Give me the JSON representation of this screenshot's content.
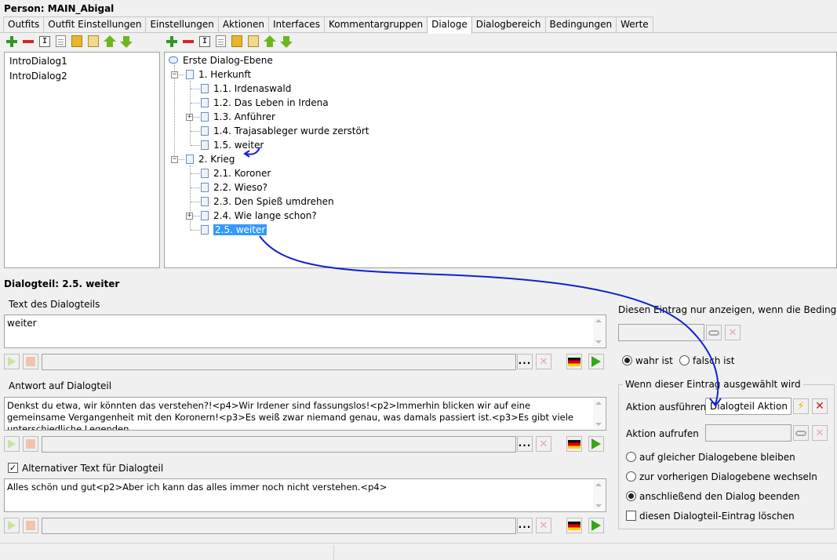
{
  "window": {
    "title": "Person: MAIN_Abigal"
  },
  "tabs": [
    {
      "label": "Outfits"
    },
    {
      "label": "Outfit Einstellungen"
    },
    {
      "label": "Einstellungen"
    },
    {
      "label": "Aktionen"
    },
    {
      "label": "Interfaces"
    },
    {
      "label": "Kommentargruppen"
    },
    {
      "label": "Dialoge",
      "active": true
    },
    {
      "label": "Dialogbereich"
    },
    {
      "label": "Bedingungen"
    },
    {
      "label": "Werte"
    }
  ],
  "toolbar_icons": [
    "add-icon",
    "remove-icon",
    "rename-icon",
    "new-document-icon",
    "copy-icon",
    "paste-icon",
    "move-up-icon",
    "move-down-icon"
  ],
  "dialog_list": {
    "items": [
      "IntroDialog1",
      "IntroDialog2"
    ],
    "selected": "IntroDialog1"
  },
  "tree": {
    "root": "Erste Dialog-Ebene",
    "nodes": [
      {
        "label": "1. Herkunft",
        "children": [
          {
            "label": "1.1. Irdenaswald"
          },
          {
            "label": "1.2. Das Leben in Irdena"
          },
          {
            "label": "1.3. Anführer",
            "expandable": true
          },
          {
            "label": "1.4. Trajasableger wurde zerstört"
          },
          {
            "label": "1.5. weiter"
          }
        ]
      },
      {
        "label": "2. Krieg",
        "children": [
          {
            "label": "2.1. Koroner"
          },
          {
            "label": "2.2. Wieso?"
          },
          {
            "label": "2.3. Den Spieß umdrehen"
          },
          {
            "label": "2.4. Wie lange schon?",
            "expandable": true
          },
          {
            "label": "2.5. weiter",
            "selected": true
          }
        ]
      }
    ]
  },
  "detail": {
    "heading": "Dialogteil: 2.5. weiter",
    "text_label": "Text des Dialogteils",
    "text_value": "weiter",
    "answer_label": "Antwort auf Dialogteil",
    "answer_value": "Denkst du etwa, wir könnten das verstehen?!<p4>Wir Irdener sind fassungslos!<p2>Immerhin blicken wir auf eine gemeinsame Vergangenheit mit den Koronern!<p3>Es weiß zwar niemand  genau, was damals passiert ist.<p3>Es gibt viele unterschiedliche Legenden",
    "alt_checkbox_label": "Alternativer Text für Dialogteil",
    "alt_checked": true,
    "alt_value": "Alles schön und gut<p2>Aber ich kann das alles immer noch nicht verstehen.<p4>",
    "dots_label": "..."
  },
  "condition": {
    "label": "Diesen Eintrag nur anzeigen, wenn die Bedingung",
    "true_label": "wahr ist",
    "false_label": "falsch ist",
    "selected": "true"
  },
  "selection": {
    "group_label": "Wenn dieser Eintrag ausgewählt wird",
    "action_exec_label": "Aktion ausführen",
    "action_exec_value": "Dialogteil Aktion",
    "action_call_label": "Aktion aufrufen",
    "options": [
      {
        "label": "auf gleicher Dialogebene bleiben",
        "selected": false
      },
      {
        "label": "zur vorherigen Dialogebene wechseln",
        "selected": false
      },
      {
        "label": "anschließend den Dialog beenden",
        "selected": true
      }
    ],
    "delete_label": "diesen Dialogteil-Eintrag löschen",
    "delete_checked": false
  },
  "colors": {
    "selection": "#3399ff",
    "annotation": "#1020d0",
    "accent_green": "#3aa41c",
    "delete_red": "#c61c1c"
  }
}
